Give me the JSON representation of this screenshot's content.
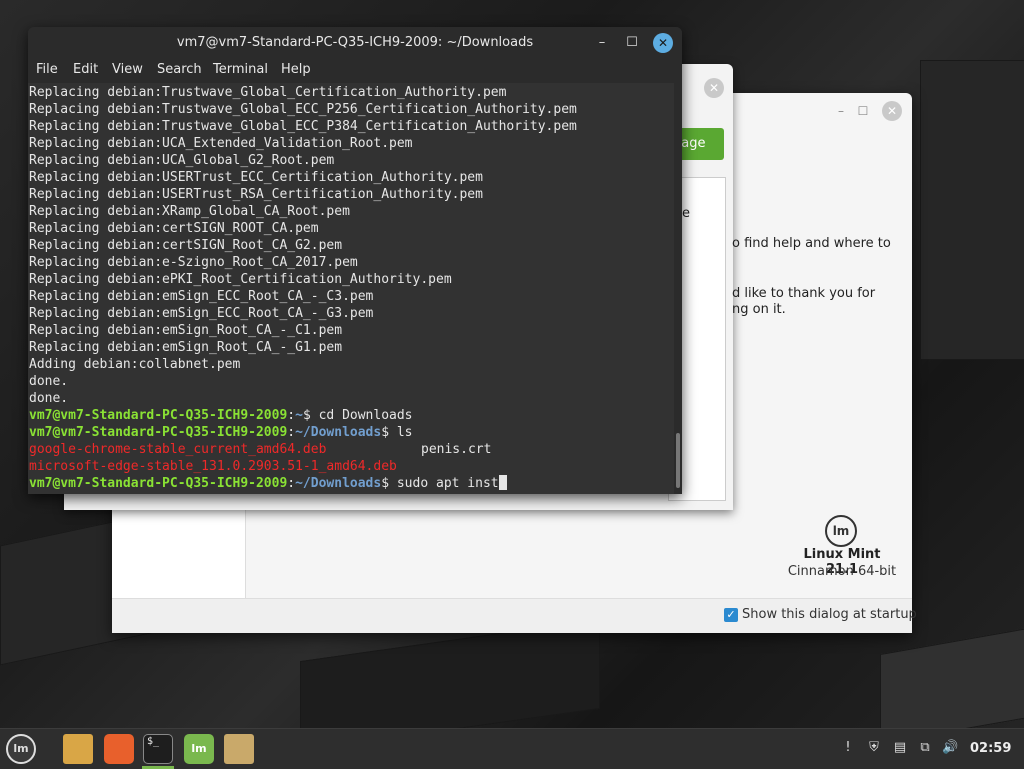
{
  "welcome_window": {
    "footer_checkbox_label": "Show this dialog at startup",
    "brand_name": "Linux Mint 21.1",
    "brand_edition": "Cinnamon 64-bit",
    "logo_text": "lm"
  },
  "middle_window": {
    "button_fragment": "kage",
    "text_fragments": [
      "e",
      "o find help and where to",
      "d like to thank you for",
      "ng on it."
    ]
  },
  "terminal": {
    "title": "vm7@vm7-Standard-PC-Q35-ICH9-2009: ~/Downloads",
    "menu": [
      "File",
      "Edit",
      "View",
      "Search",
      "Terminal",
      "Help"
    ],
    "lines": [
      "Replacing debian:Trustwave_Global_Certification_Authority.pem",
      "Replacing debian:Trustwave_Global_ECC_P256_Certification_Authority.pem",
      "Replacing debian:Trustwave_Global_ECC_P384_Certification_Authority.pem",
      "Replacing debian:UCA_Extended_Validation_Root.pem",
      "Replacing debian:UCA_Global_G2_Root.pem",
      "Replacing debian:USERTrust_ECC_Certification_Authority.pem",
      "Replacing debian:USERTrust_RSA_Certification_Authority.pem",
      "Replacing debian:XRamp_Global_CA_Root.pem",
      "Replacing debian:certSIGN_ROOT_CA.pem",
      "Replacing debian:certSIGN_Root_CA_G2.pem",
      "Replacing debian:e-Szigno_Root_CA_2017.pem",
      "Replacing debian:ePKI_Root_Certification_Authority.pem",
      "Replacing debian:emSign_ECC_Root_CA_-_C3.pem",
      "Replacing debian:emSign_ECC_Root_CA_-_G3.pem",
      "Replacing debian:emSign_Root_CA_-_C1.pem",
      "Replacing debian:emSign_Root_CA_-_G1.pem",
      "Adding debian:collabnet.pem",
      "done.",
      "done."
    ],
    "prompt_user": "vm7@vm7-Standard-PC-Q35-ICH9-2009",
    "cmd1_path": "~",
    "cmd1": "$ cd Downloads",
    "cmd2_path": "~/Downloads",
    "cmd2": "$ ls",
    "ls_file1": "google-chrome-stable_current_amd64.deb",
    "ls_file2": "penis.crt",
    "ls_file3": "microsoft-edge-stable_131.0.2903.51-1_amd64.deb",
    "cmd3_path": "~/Downloads",
    "cmd3": "$ sudo apt inst"
  },
  "taskbar": {
    "clock": "02:59",
    "apps": [
      "menu-icon",
      "files-icon",
      "firefox-icon",
      "terminal-icon",
      "mintinstall-icon",
      "folder-icon"
    ]
  }
}
